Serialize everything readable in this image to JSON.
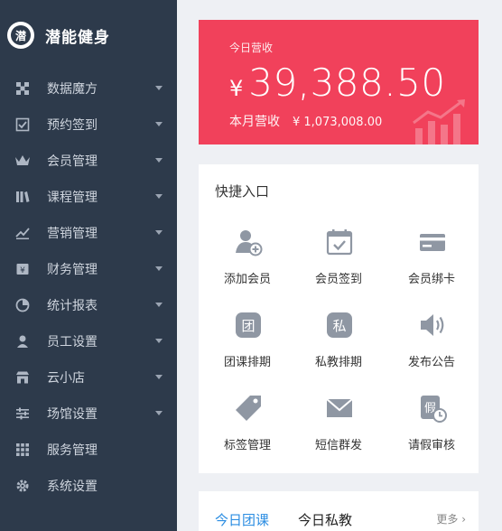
{
  "brand": {
    "name": "潜能健身",
    "logo_glyph": "潜"
  },
  "sidebar": {
    "items": [
      {
        "label": "数据魔方",
        "icon": "cube-grid-icon",
        "has_caret": true
      },
      {
        "label": "预约签到",
        "icon": "checkbox-icon",
        "has_caret": true
      },
      {
        "label": "会员管理",
        "icon": "crown-icon",
        "has_caret": true
      },
      {
        "label": "课程管理",
        "icon": "books-icon",
        "has_caret": true
      },
      {
        "label": "营销管理",
        "icon": "trend-chart-icon",
        "has_caret": true
      },
      {
        "label": "财务管理",
        "icon": "cash-icon",
        "has_caret": true
      },
      {
        "label": "统计报表",
        "icon": "pie-chart-icon",
        "has_caret": true
      },
      {
        "label": "员工设置",
        "icon": "user-icon",
        "has_caret": true
      },
      {
        "label": "云小店",
        "icon": "store-icon",
        "has_caret": true
      },
      {
        "label": "场馆设置",
        "icon": "sliders-icon",
        "has_caret": true
      },
      {
        "label": "服务管理",
        "icon": "apps-grid-icon",
        "has_caret": false
      },
      {
        "label": "系统设置",
        "icon": "gear-icon",
        "has_caret": false
      }
    ]
  },
  "revenue": {
    "today_label": "今日营收",
    "currency": "¥",
    "today_value": "39,388.50",
    "month_label": "本月营收",
    "month_value": "¥ 1,073,008.00",
    "color": "#f1415b"
  },
  "quick": {
    "title": "快捷入口",
    "items": [
      {
        "label": "添加会员",
        "icon": "add-user-icon"
      },
      {
        "label": "会员签到",
        "icon": "calendar-check-icon"
      },
      {
        "label": "会员绑卡",
        "icon": "card-icon"
      },
      {
        "label": "团课排期",
        "icon": "group-class-icon",
        "glyph": "团"
      },
      {
        "label": "私教排期",
        "icon": "private-class-icon",
        "glyph": "私"
      },
      {
        "label": "发布公告",
        "icon": "speaker-icon"
      },
      {
        "label": "标签管理",
        "icon": "tag-icon"
      },
      {
        "label": "短信群发",
        "icon": "mail-icon"
      },
      {
        "label": "请假审核",
        "icon": "leave-review-icon",
        "glyph": "假"
      }
    ]
  },
  "tabs": {
    "items": [
      "今日团课",
      "今日私教"
    ],
    "more": "更多 ›",
    "accent": "#2b8de2"
  }
}
